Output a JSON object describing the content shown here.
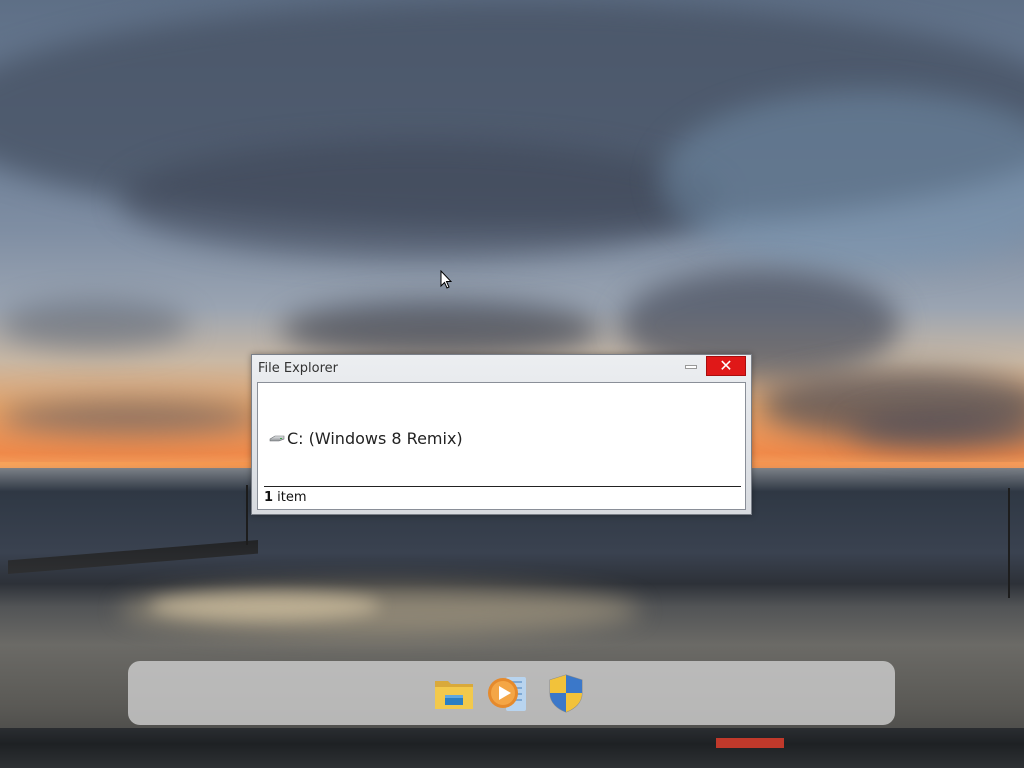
{
  "window": {
    "title": "File Explorer",
    "close_label": "✕",
    "items": [
      {
        "label": "C: (Windows 8 Remix)",
        "icon": "drive-icon"
      }
    ],
    "status": {
      "count": "1",
      "unit": " item"
    }
  },
  "taskbar": {
    "apps": [
      {
        "name": "file-explorer",
        "icon": "folder-icon"
      },
      {
        "name": "media-player",
        "icon": "media-player-icon"
      },
      {
        "name": "security",
        "icon": "shield-icon"
      }
    ]
  },
  "colors": {
    "close_button": "#e01818",
    "window_chrome": "#dde0e4",
    "dock": "#cdcdcd"
  }
}
